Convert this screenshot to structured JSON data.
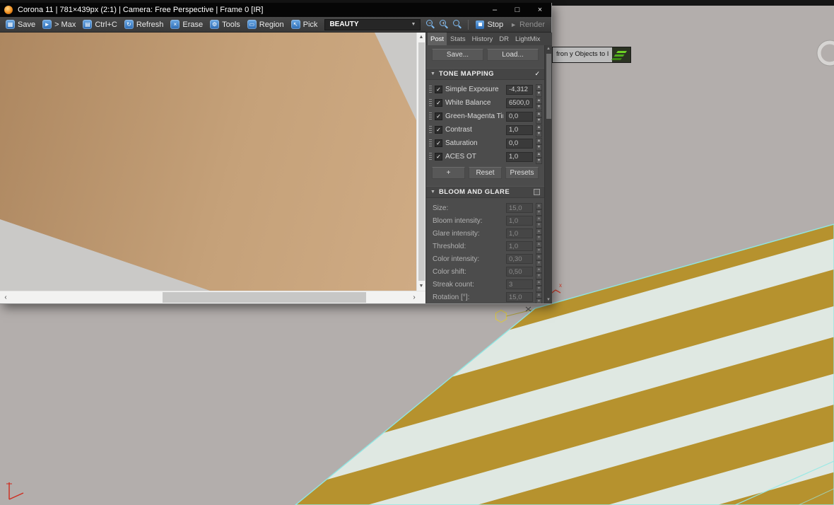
{
  "window": {
    "title": "Corona 11 | 781×439px (2:1) | Camera: Free Perspective | Frame 0 [IR]",
    "controls": {
      "minimize": "–",
      "maximize": "□",
      "close": "×"
    }
  },
  "toolbar": {
    "buttons": [
      {
        "icon": "save-icon",
        "glyph": "▦",
        "label": "Save"
      },
      {
        "icon": "send-to-max-icon",
        "glyph": "►",
        "label": "> Max"
      },
      {
        "icon": "copy-icon",
        "glyph": "▤",
        "label": "Ctrl+C"
      },
      {
        "icon": "refresh-icon",
        "glyph": "↻",
        "label": "Refresh"
      },
      {
        "icon": "erase-icon",
        "glyph": "×",
        "label": "Erase"
      },
      {
        "icon": "tools-icon",
        "glyph": "⚙",
        "label": "Tools"
      },
      {
        "icon": "region-icon",
        "glyph": "▭",
        "label": "Region"
      },
      {
        "icon": "pick-icon",
        "glyph": "↖",
        "label": "Pick"
      }
    ],
    "render_element": "BEAUTY",
    "zoom": {
      "out": "−",
      "in": "+",
      "fit": ""
    },
    "stop_label": "Stop",
    "render_label": "Render"
  },
  "panel": {
    "tabs": [
      "Post",
      "Stats",
      "History",
      "DR",
      "LightMix"
    ],
    "active_tab": "Post",
    "save_button": "Save...",
    "load_button": "Load...",
    "tone_mapping": {
      "title": "TONE MAPPING",
      "enabled_check": "✓",
      "rows": [
        {
          "label": "Simple Exposure",
          "value": "-4,312",
          "checked": true
        },
        {
          "label": "White Balance",
          "value": "6500,0",
          "checked": true
        },
        {
          "label": "Green-Magenta Tint",
          "value": "0,0",
          "checked": true
        },
        {
          "label": "Contrast",
          "value": "1,0",
          "checked": true
        },
        {
          "label": "Saturation",
          "value": "0,0",
          "checked": true
        },
        {
          "label": "ACES OT",
          "value": "1,0",
          "checked": true
        }
      ],
      "add_button": "+",
      "reset_button": "Reset",
      "presets_button": "Presets"
    },
    "bloom_glare": {
      "title": "BLOOM AND GLARE",
      "rows": [
        {
          "label": "Size:",
          "value": "15,0"
        },
        {
          "label": "Bloom intensity:",
          "value": "1,0"
        },
        {
          "label": "Glare intensity:",
          "value": "1,0"
        },
        {
          "label": "Threshold:",
          "value": "1,0"
        },
        {
          "label": "Color intensity:",
          "value": "0,30"
        },
        {
          "label": "Color shift:",
          "value": "0,50"
        },
        {
          "label": "Streak count:",
          "value": "3"
        },
        {
          "label": "Rotation [°]:",
          "value": "15,0"
        }
      ]
    }
  },
  "tooltip": {
    "text": "fron y Objects to I"
  },
  "colors": {
    "stripe_gold": "#b6922e",
    "stripe_pale": "#dfe8e2",
    "selection_cyan": "#90e6e2",
    "render_tan": "#c5a179",
    "icon_blue": "#2d6cb4"
  }
}
